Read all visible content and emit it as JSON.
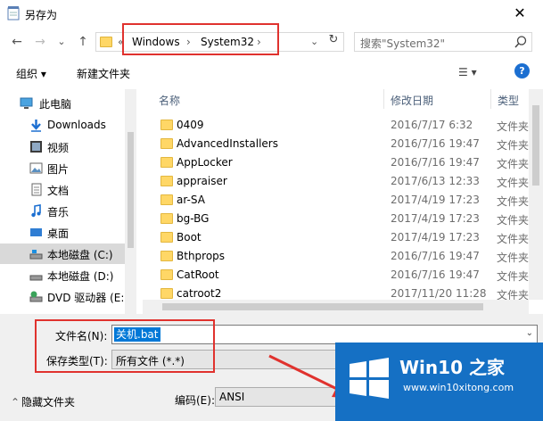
{
  "window": {
    "title": "另存为",
    "close_label": "✕"
  },
  "nav": {
    "back": "←",
    "forward": "→",
    "dropdown": "⌄",
    "up": "↑"
  },
  "address": {
    "overflow": "«",
    "crumbs": [
      "Windows",
      "System32"
    ],
    "sep": "›",
    "chevron": "⌄",
    "refresh": "↻"
  },
  "search": {
    "placeholder": "搜索\"System32\""
  },
  "toolbar": {
    "organize": "组织 ▾",
    "new_folder": "新建文件夹",
    "view": "☰ ▾",
    "help": "?"
  },
  "sidebar": {
    "items": [
      {
        "label": "此电脑",
        "icon": "pc-icon",
        "selected": false
      },
      {
        "label": "Downloads",
        "icon": "download-icon",
        "selected": false
      },
      {
        "label": "视频",
        "icon": "video-icon",
        "selected": false
      },
      {
        "label": "图片",
        "icon": "picture-icon",
        "selected": false
      },
      {
        "label": "文档",
        "icon": "document-icon",
        "selected": false
      },
      {
        "label": "音乐",
        "icon": "music-icon",
        "selected": false
      },
      {
        "label": "桌面",
        "icon": "desktop-icon",
        "selected": false
      },
      {
        "label": "本地磁盘 (C:)",
        "icon": "drive-icon",
        "selected": true
      },
      {
        "label": "本地磁盘 (D:)",
        "icon": "drive-icon",
        "selected": false
      },
      {
        "label": "DVD 驱动器 (E:)",
        "icon": "dvd-drive-icon",
        "selected": false
      }
    ]
  },
  "filelist": {
    "columns": {
      "name": "名称",
      "date": "修改日期",
      "type": "类型"
    },
    "rows": [
      {
        "name": "0409",
        "date": "2016/7/17 6:32",
        "type": "文件夹"
      },
      {
        "name": "AdvancedInstallers",
        "date": "2016/7/16 19:47",
        "type": "文件夹"
      },
      {
        "name": "AppLocker",
        "date": "2016/7/16 19:47",
        "type": "文件夹"
      },
      {
        "name": "appraiser",
        "date": "2017/6/13 12:33",
        "type": "文件夹"
      },
      {
        "name": "ar-SA",
        "date": "2017/4/19 17:23",
        "type": "文件夹"
      },
      {
        "name": "bg-BG",
        "date": "2017/4/19 17:23",
        "type": "文件夹"
      },
      {
        "name": "Boot",
        "date": "2017/4/19 17:23",
        "type": "文件夹"
      },
      {
        "name": "Bthprops",
        "date": "2016/7/16 19:47",
        "type": "文件夹"
      },
      {
        "name": "CatRoot",
        "date": "2016/7/16 19:47",
        "type": "文件夹"
      },
      {
        "name": "catroot2",
        "date": "2017/11/20 11:28",
        "type": "文件夹"
      }
    ]
  },
  "save": {
    "filename_label": "文件名(N):",
    "filename_value": "关机.bat",
    "filetype_label": "保存类型(T):",
    "filetype_value": "所有文件 (*.*)",
    "hide_folders": "隐藏文件夹",
    "encoding_label": "编码(E):",
    "encoding_value": "ANSI"
  },
  "watermark": {
    "brand": "Win10 之家",
    "url": "www.win10xitong.com"
  },
  "colors": {
    "accent": "#0078d7",
    "highlight_red": "#e0322e",
    "logo_blue": "#1570c4"
  }
}
